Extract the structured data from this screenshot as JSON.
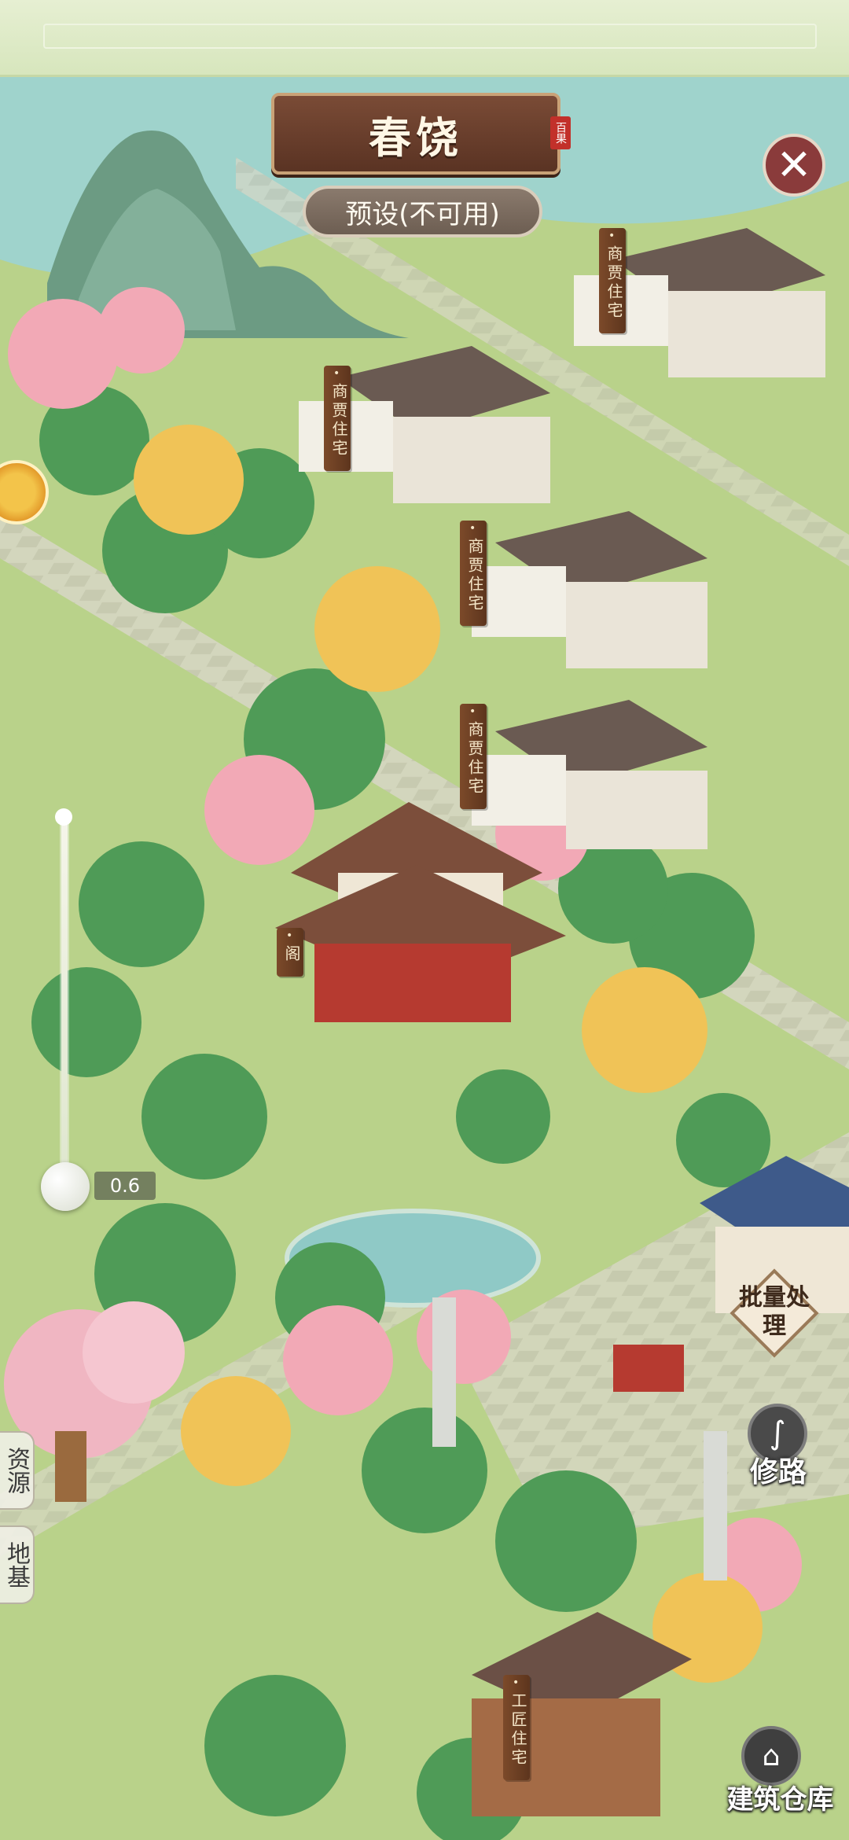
{
  "title": "春饶",
  "seal_text": "百果",
  "preset_button": "预设(不可用)",
  "close_icon": "close-icon",
  "building_tags": [
    "商贾住宅",
    "商贾住宅",
    "商贾住宅",
    "商贾住宅",
    "阁",
    "工匠住宅"
  ],
  "zoom": {
    "value_label": "0.6"
  },
  "side_tabs": {
    "resources": "资源",
    "foundation": "地基"
  },
  "buttons": {
    "batch": "批量处理",
    "road": "修路",
    "warehouse": "建筑仓库"
  },
  "colors": {
    "grass": "#b9d28a",
    "path": "#cfcfc0",
    "water": "#8fc9c6",
    "banner": "#6a3f2c",
    "tag": "#6d3f22"
  }
}
